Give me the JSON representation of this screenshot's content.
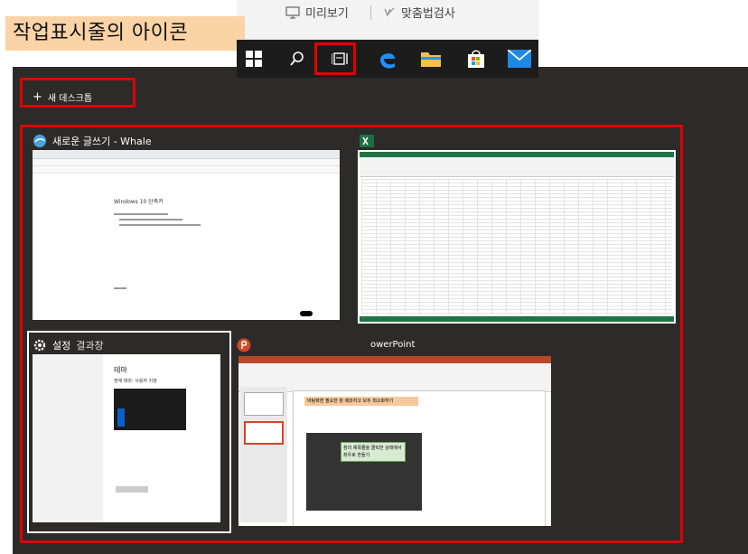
{
  "ribbon": {
    "preview_label": "미리보기",
    "spellcheck_label": "맞춤법검사"
  },
  "caption": {
    "text": "작업표시줄의 아이콘"
  },
  "taskbar": {
    "icons": [
      "windows-start-icon",
      "search-icon",
      "task-view-icon",
      "edge-icon",
      "file-explorer-icon",
      "store-icon",
      "mail-icon"
    ]
  },
  "taskview": {
    "new_desktop_label": "새 데스크톱",
    "windows": [
      {
        "title": "새로운 글쓰기 - Whale",
        "doc_heading": "Windows 10 단축키"
      },
      {
        "title": ""
      },
      {
        "title": "설정",
        "settings_title": "테마",
        "settings_subtitle": "현재 테마: 사용자 지정"
      },
      {
        "title": "owerPoint",
        "callout1": "바탕화면 필요한 창 제외하고 모두 최소화하기",
        "callout2": "창의 제목줄을 클릭한 상태에서 좌우로 흔들기"
      }
    ],
    "watermark": "결과창"
  },
  "colors": {
    "highlight": "#e00000",
    "caption_bg": "#fad3a6",
    "taskbar_bg": "#1c1c1c",
    "taskview_bg": "#2d2b29"
  }
}
